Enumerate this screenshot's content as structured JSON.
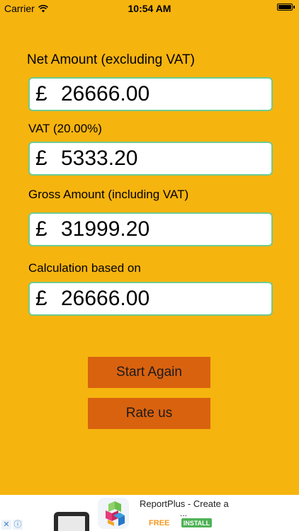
{
  "status_bar": {
    "carrier": "Carrier",
    "time": "10:54 AM",
    "icons": [
      "wifi-icon",
      "battery-icon"
    ]
  },
  "form": {
    "net_label": "Net Amount (excluding VAT)",
    "net_currency": "£",
    "net_value": "26666.00",
    "vat_label": "VAT (20.00%)",
    "vat_currency": "£",
    "vat_value": "5333.20",
    "gross_label": "Gross Amount (including VAT)",
    "gross_currency": "£",
    "gross_value": "31999.20",
    "basis_label": "Calculation based on",
    "basis_currency": "£",
    "basis_value": "26666.00"
  },
  "buttons": {
    "start_again": "Start Again",
    "rate_us": "Rate us"
  },
  "ad": {
    "title": "ReportPlus - Create a",
    "ellipsis": "...",
    "price": "FREE",
    "install": "INSTALL",
    "close_glyph": "✕",
    "info_glyph": "ⓘ"
  },
  "colors": {
    "background": "#F6B40F",
    "field_border": "#6FCB8F",
    "button": "#D9620F",
    "install_button": "#4FB256",
    "free_text": "#F39A1E"
  }
}
